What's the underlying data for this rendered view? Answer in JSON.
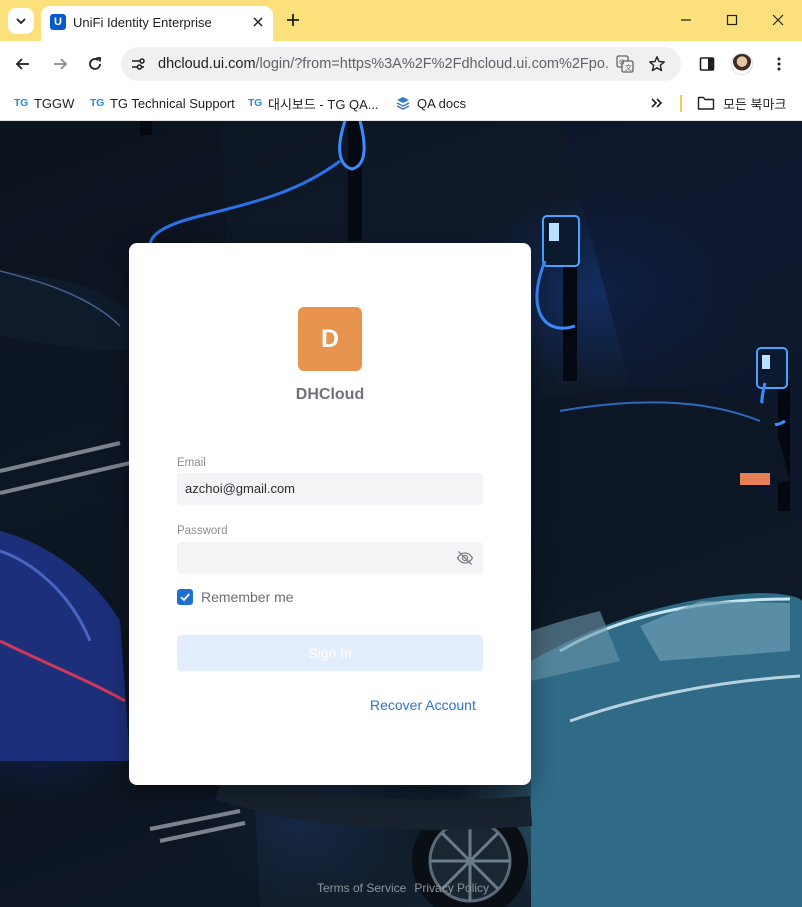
{
  "browser": {
    "tab_title": "UniFi Identity Enterprise",
    "tab_favicon": "U",
    "url_host": "dhcloud.ui.com",
    "url_rest": "/login/?from=https%3A%2F%2Fdhcloud.ui.com%2Fpo...",
    "bookmarks": [
      {
        "icon": "TG",
        "label": "TGGW"
      },
      {
        "icon": "TG",
        "label": "TG Technical Support"
      },
      {
        "icon": "TG",
        "label": "대시보드 - TG QA..."
      },
      {
        "icon": "qa-docs-icon",
        "label": "QA docs"
      }
    ],
    "all_bookmarks_label": "모든 북마크"
  },
  "login": {
    "logo_letter": "D",
    "logo_color": "#e8944f",
    "org_name": "DHCloud",
    "email_label": "Email",
    "email_value": "azchoi@gmail.com",
    "password_label": "Password",
    "password_value": "",
    "remember_label": "Remember me",
    "remember_checked": true,
    "signin_label": "Sign In",
    "recover_label": "Recover Account",
    "accent_color": "#1f6fd1"
  },
  "footer": {
    "terms": "Terms of Service",
    "privacy": "Privacy Policy"
  }
}
